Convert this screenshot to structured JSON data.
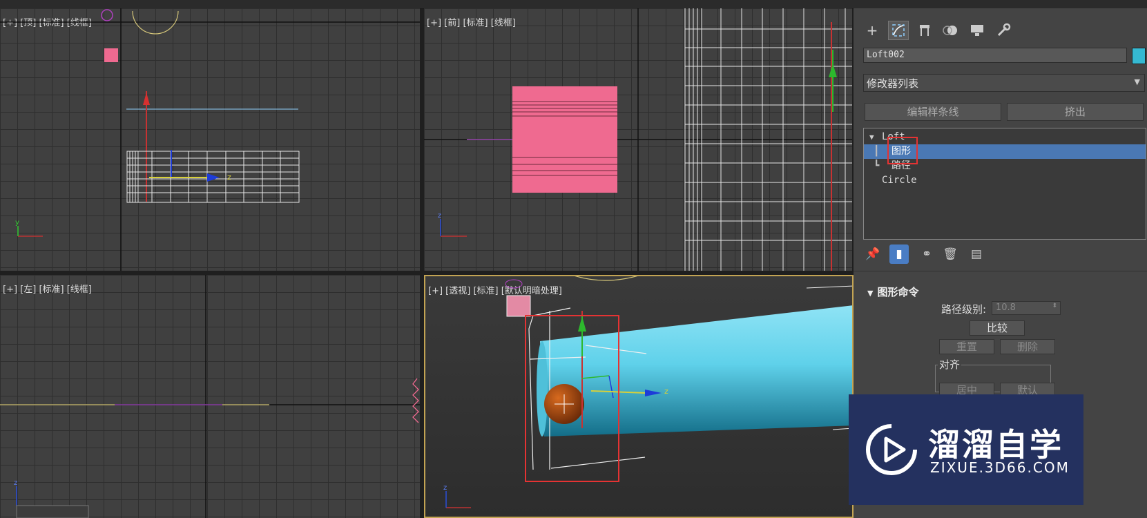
{
  "viewports": {
    "top": {
      "label": "[+] [顶] [标准] [线框]"
    },
    "front": {
      "label": "[+] [前] [标准] [线框]"
    },
    "left": {
      "label": "[+] [左] [标准] [线框]"
    },
    "perspective": {
      "label": "[+] [透视] [标准] [默认明暗处理]"
    }
  },
  "axis_labels": {
    "z": "z",
    "y": "y"
  },
  "panel": {
    "tabs": [
      {
        "icon": "plus-icon",
        "glyph": "+"
      },
      {
        "icon": "modify-icon",
        "glyph": "⌜"
      },
      {
        "icon": "hierarchy-icon",
        "glyph": "⊓"
      },
      {
        "icon": "motion-icon",
        "glyph": "●"
      },
      {
        "icon": "display-icon",
        "glyph": "▬"
      },
      {
        "icon": "utilities-icon",
        "glyph": "🔧"
      }
    ],
    "object_name": "Loft002",
    "object_color": "#35b9d2",
    "modifier_list": "修改器列表",
    "buttons": {
      "edit_spline": "编辑样条线",
      "extrude": "挤出"
    },
    "stack": {
      "loft": "Loft",
      "shape": "图形",
      "path": "路径",
      "circle": "Circle"
    },
    "stack_icons": [
      "pin-stack-icon",
      "show-end-result-icon",
      "make-unique-icon",
      "remove-modifier-icon",
      "configure-sets-icon"
    ],
    "rollout": {
      "title": "图形命令",
      "path_level_label": "路径级别:",
      "path_level_value": "10.8",
      "compare": "比较",
      "reset": "重置",
      "delete": "删除",
      "align_group": "对齐",
      "center": "居中",
      "default": "默认"
    }
  },
  "watermark": {
    "title": "溜溜自学",
    "url": "ZIXUE.3D66.COM"
  },
  "colors": {
    "highlight_red": "#e53333",
    "selection_blue": "#4a78b4",
    "tube_cyan": "#5fd1ea",
    "pink": "#ef6a90"
  }
}
